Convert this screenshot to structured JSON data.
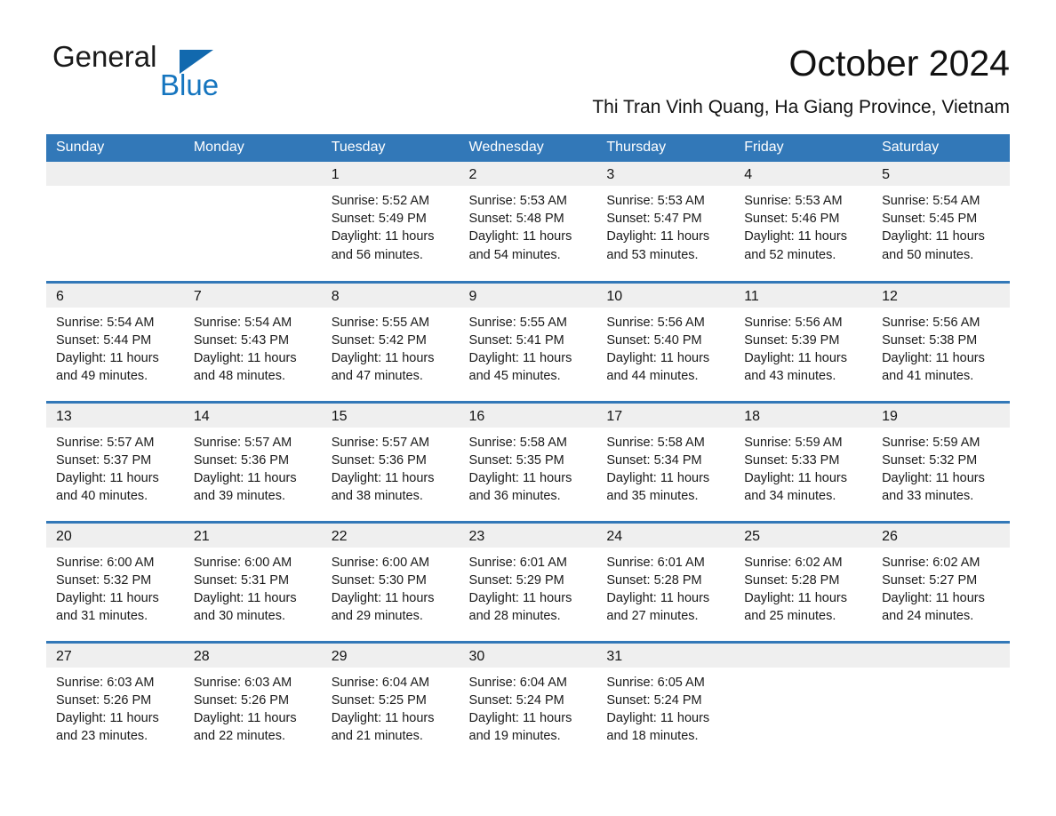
{
  "brand": {
    "name_part1": "General",
    "name_part2": "Blue",
    "triangle_color": "#1269ae",
    "blue_color": "#1575bf"
  },
  "header": {
    "month_title": "October 2024",
    "location": "Thi Tran Vinh Quang, Ha Giang Province, Vietnam",
    "accent_color": "#3278b8",
    "band_color": "#efefef"
  },
  "weekdays": [
    "Sunday",
    "Monday",
    "Tuesday",
    "Wednesday",
    "Thursday",
    "Friday",
    "Saturday"
  ],
  "labels": {
    "sunrise_prefix": "Sunrise:",
    "sunset_prefix": "Sunset:",
    "daylight_prefix": "Daylight:"
  },
  "weeks": [
    [
      {
        "day": "",
        "empty": true
      },
      {
        "day": "",
        "empty": true
      },
      {
        "day": "1",
        "sunrise": "Sunrise: 5:52 AM",
        "sunset": "Sunset: 5:49 PM",
        "daylight_1": "Daylight: 11 hours",
        "daylight_2": "and 56 minutes."
      },
      {
        "day": "2",
        "sunrise": "Sunrise: 5:53 AM",
        "sunset": "Sunset: 5:48 PM",
        "daylight_1": "Daylight: 11 hours",
        "daylight_2": "and 54 minutes."
      },
      {
        "day": "3",
        "sunrise": "Sunrise: 5:53 AM",
        "sunset": "Sunset: 5:47 PM",
        "daylight_1": "Daylight: 11 hours",
        "daylight_2": "and 53 minutes."
      },
      {
        "day": "4",
        "sunrise": "Sunrise: 5:53 AM",
        "sunset": "Sunset: 5:46 PM",
        "daylight_1": "Daylight: 11 hours",
        "daylight_2": "and 52 minutes."
      },
      {
        "day": "5",
        "sunrise": "Sunrise: 5:54 AM",
        "sunset": "Sunset: 5:45 PM",
        "daylight_1": "Daylight: 11 hours",
        "daylight_2": "and 50 minutes."
      }
    ],
    [
      {
        "day": "6",
        "sunrise": "Sunrise: 5:54 AM",
        "sunset": "Sunset: 5:44 PM",
        "daylight_1": "Daylight: 11 hours",
        "daylight_2": "and 49 minutes."
      },
      {
        "day": "7",
        "sunrise": "Sunrise: 5:54 AM",
        "sunset": "Sunset: 5:43 PM",
        "daylight_1": "Daylight: 11 hours",
        "daylight_2": "and 48 minutes."
      },
      {
        "day": "8",
        "sunrise": "Sunrise: 5:55 AM",
        "sunset": "Sunset: 5:42 PM",
        "daylight_1": "Daylight: 11 hours",
        "daylight_2": "and 47 minutes."
      },
      {
        "day": "9",
        "sunrise": "Sunrise: 5:55 AM",
        "sunset": "Sunset: 5:41 PM",
        "daylight_1": "Daylight: 11 hours",
        "daylight_2": "and 45 minutes."
      },
      {
        "day": "10",
        "sunrise": "Sunrise: 5:56 AM",
        "sunset": "Sunset: 5:40 PM",
        "daylight_1": "Daylight: 11 hours",
        "daylight_2": "and 44 minutes."
      },
      {
        "day": "11",
        "sunrise": "Sunrise: 5:56 AM",
        "sunset": "Sunset: 5:39 PM",
        "daylight_1": "Daylight: 11 hours",
        "daylight_2": "and 43 minutes."
      },
      {
        "day": "12",
        "sunrise": "Sunrise: 5:56 AM",
        "sunset": "Sunset: 5:38 PM",
        "daylight_1": "Daylight: 11 hours",
        "daylight_2": "and 41 minutes."
      }
    ],
    [
      {
        "day": "13",
        "sunrise": "Sunrise: 5:57 AM",
        "sunset": "Sunset: 5:37 PM",
        "daylight_1": "Daylight: 11 hours",
        "daylight_2": "and 40 minutes."
      },
      {
        "day": "14",
        "sunrise": "Sunrise: 5:57 AM",
        "sunset": "Sunset: 5:36 PM",
        "daylight_1": "Daylight: 11 hours",
        "daylight_2": "and 39 minutes."
      },
      {
        "day": "15",
        "sunrise": "Sunrise: 5:57 AM",
        "sunset": "Sunset: 5:36 PM",
        "daylight_1": "Daylight: 11 hours",
        "daylight_2": "and 38 minutes."
      },
      {
        "day": "16",
        "sunrise": "Sunrise: 5:58 AM",
        "sunset": "Sunset: 5:35 PM",
        "daylight_1": "Daylight: 11 hours",
        "daylight_2": "and 36 minutes."
      },
      {
        "day": "17",
        "sunrise": "Sunrise: 5:58 AM",
        "sunset": "Sunset: 5:34 PM",
        "daylight_1": "Daylight: 11 hours",
        "daylight_2": "and 35 minutes."
      },
      {
        "day": "18",
        "sunrise": "Sunrise: 5:59 AM",
        "sunset": "Sunset: 5:33 PM",
        "daylight_1": "Daylight: 11 hours",
        "daylight_2": "and 34 minutes."
      },
      {
        "day": "19",
        "sunrise": "Sunrise: 5:59 AM",
        "sunset": "Sunset: 5:32 PM",
        "daylight_1": "Daylight: 11 hours",
        "daylight_2": "and 33 minutes."
      }
    ],
    [
      {
        "day": "20",
        "sunrise": "Sunrise: 6:00 AM",
        "sunset": "Sunset: 5:32 PM",
        "daylight_1": "Daylight: 11 hours",
        "daylight_2": "and 31 minutes."
      },
      {
        "day": "21",
        "sunrise": "Sunrise: 6:00 AM",
        "sunset": "Sunset: 5:31 PM",
        "daylight_1": "Daylight: 11 hours",
        "daylight_2": "and 30 minutes."
      },
      {
        "day": "22",
        "sunrise": "Sunrise: 6:00 AM",
        "sunset": "Sunset: 5:30 PM",
        "daylight_1": "Daylight: 11 hours",
        "daylight_2": "and 29 minutes."
      },
      {
        "day": "23",
        "sunrise": "Sunrise: 6:01 AM",
        "sunset": "Sunset: 5:29 PM",
        "daylight_1": "Daylight: 11 hours",
        "daylight_2": "and 28 minutes."
      },
      {
        "day": "24",
        "sunrise": "Sunrise: 6:01 AM",
        "sunset": "Sunset: 5:28 PM",
        "daylight_1": "Daylight: 11 hours",
        "daylight_2": "and 27 minutes."
      },
      {
        "day": "25",
        "sunrise": "Sunrise: 6:02 AM",
        "sunset": "Sunset: 5:28 PM",
        "daylight_1": "Daylight: 11 hours",
        "daylight_2": "and 25 minutes."
      },
      {
        "day": "26",
        "sunrise": "Sunrise: 6:02 AM",
        "sunset": "Sunset: 5:27 PM",
        "daylight_1": "Daylight: 11 hours",
        "daylight_2": "and 24 minutes."
      }
    ],
    [
      {
        "day": "27",
        "sunrise": "Sunrise: 6:03 AM",
        "sunset": "Sunset: 5:26 PM",
        "daylight_1": "Daylight: 11 hours",
        "daylight_2": "and 23 minutes."
      },
      {
        "day": "28",
        "sunrise": "Sunrise: 6:03 AM",
        "sunset": "Sunset: 5:26 PM",
        "daylight_1": "Daylight: 11 hours",
        "daylight_2": "and 22 minutes."
      },
      {
        "day": "29",
        "sunrise": "Sunrise: 6:04 AM",
        "sunset": "Sunset: 5:25 PM",
        "daylight_1": "Daylight: 11 hours",
        "daylight_2": "and 21 minutes."
      },
      {
        "day": "30",
        "sunrise": "Sunrise: 6:04 AM",
        "sunset": "Sunset: 5:24 PM",
        "daylight_1": "Daylight: 11 hours",
        "daylight_2": "and 19 minutes."
      },
      {
        "day": "31",
        "sunrise": "Sunrise: 6:05 AM",
        "sunset": "Sunset: 5:24 PM",
        "daylight_1": "Daylight: 11 hours",
        "daylight_2": "and 18 minutes."
      },
      {
        "day": "",
        "empty": true
      },
      {
        "day": "",
        "empty": true
      }
    ]
  ]
}
